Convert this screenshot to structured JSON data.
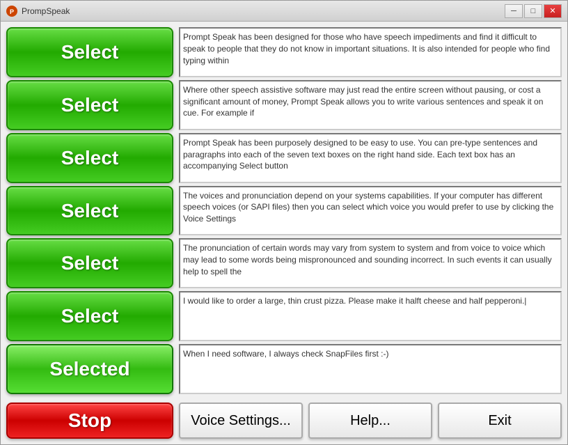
{
  "window": {
    "title": "PrompSpeak",
    "icon": "☆"
  },
  "titlebar": {
    "minimize_label": "─",
    "restore_label": "□",
    "close_label": "✕"
  },
  "rows": [
    {
      "id": "row1",
      "button_label": "Select",
      "state": "normal",
      "text": "Prompt Speak has been designed for those who have speech impediments and find it difficult to speak to people that they do not know in important situations. It is also intended for people who find typing within"
    },
    {
      "id": "row2",
      "button_label": "Select",
      "state": "normal",
      "text": "Where other speech assistive software may just read the entire screen without pausing, or cost a significant amount of money, Prompt Speak allows you to write various sentences and speak it on cue. For example if"
    },
    {
      "id": "row3",
      "button_label": "Select",
      "state": "normal",
      "text": "Prompt Speak has been purposely designed to be easy to use. You can pre-type sentences and paragraphs into each of the seven text boxes on the right hand side. Each text box has an accompanying Select button"
    },
    {
      "id": "row4",
      "button_label": "Select",
      "state": "normal",
      "text": "The voices and pronunciation depend on your systems capabilities. If your computer has different speech voices (or SAPI files) then you can select which voice you would prefer to use by clicking the Voice Settings"
    },
    {
      "id": "row5",
      "button_label": "Select",
      "state": "normal",
      "text": "The pronunciation of certain words may vary from system to system and from voice to voice which may lead to some words being mispronounced and sounding incorrect. In such events it can usually help to spell the"
    },
    {
      "id": "row6",
      "button_label": "Select",
      "state": "normal",
      "text": "I would like to order a large, thin crust pizza. Please make it halft cheese and half pepperoni.|"
    },
    {
      "id": "row7",
      "button_label": "Selected",
      "state": "selected",
      "text": "When I need software, I always check SnapFiles first :-)"
    }
  ],
  "bottom": {
    "stop_label": "Stop",
    "voice_settings_label": "Voice Settings...",
    "help_label": "Help...",
    "exit_label": "Exit"
  }
}
